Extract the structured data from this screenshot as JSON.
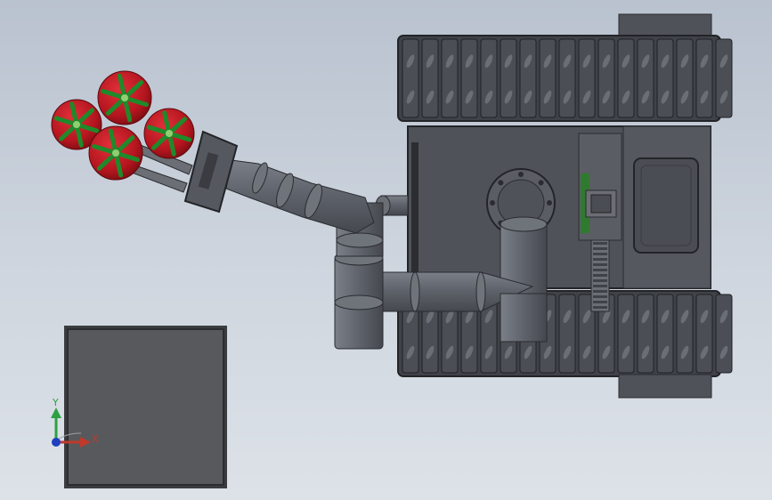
{
  "viewport": {
    "background_top": "#b9c2cf",
    "background_bottom": "#dde2e8"
  },
  "model": {
    "body_color": "#4f5259",
    "track_color": "#3f4248",
    "arm_color": "#5f636b",
    "tomato_color": "#b3151e",
    "calyx_color": "#1f8a2a",
    "gear_color": "#6b6e74",
    "guard_color": "#2f7a2f"
  },
  "triad": {
    "x_label": "X",
    "y_label": "Y",
    "x_color": "#c0392b",
    "y_color": "#2ea043",
    "z_color": "#1f3fbf"
  },
  "icons": [
    "xyz-triad-icon"
  ]
}
